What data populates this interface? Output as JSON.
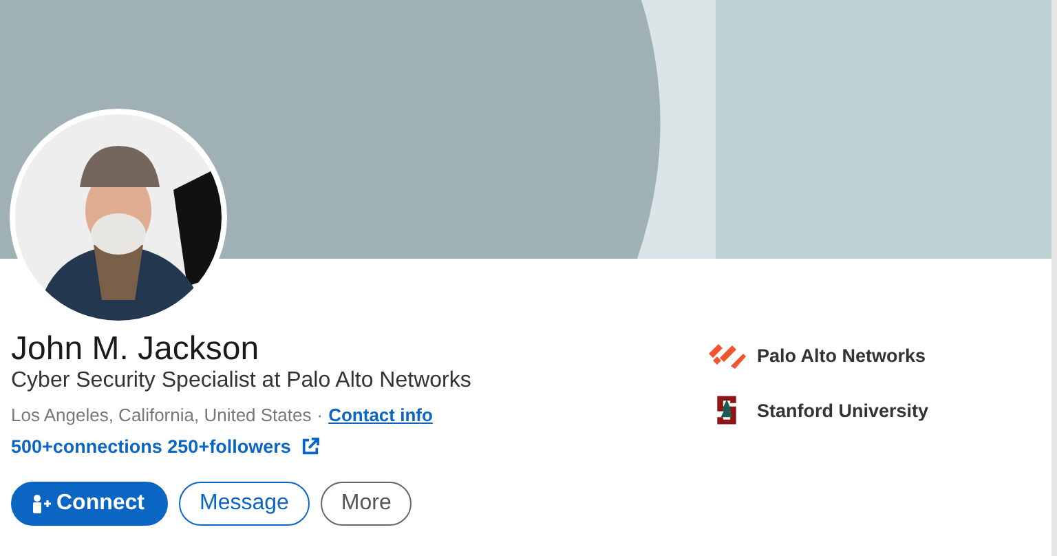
{
  "profile": {
    "name": "John M. Jackson",
    "headline": "Cyber Security Specialist at Palo Alto Networks",
    "location": "Los Angeles, California, United States",
    "separator": "·",
    "contact_link": "Contact info",
    "network_link": "500+connections 250+followers"
  },
  "actions": [
    {
      "label": "Connect",
      "kind": "primary"
    },
    {
      "label": "Message",
      "kind": "outline"
    },
    {
      "label": "More",
      "kind": "secondary"
    }
  ],
  "affiliations": [
    {
      "name": "Palo Alto Networks",
      "kind": "company"
    },
    {
      "name": "Stanford University",
      "kind": "school"
    }
  ]
}
